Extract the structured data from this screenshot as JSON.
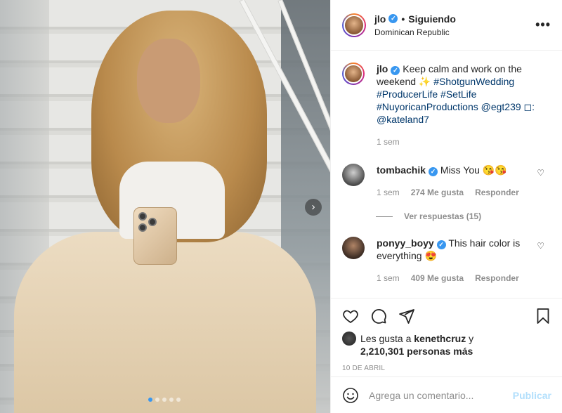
{
  "post": {
    "username": "jlo",
    "follow_label": "Siguiendo",
    "location": "Dominican Republic",
    "more_label": "•••",
    "carousel_next": "›",
    "carousel_dots": 5,
    "active_dot": 0
  },
  "caption": {
    "username": "jlo",
    "text": "Keep calm and work on the weekend ✨ ",
    "hashtags": "#ShotgunWedding #ProducerLife #SetLife #NuyoricanProductions @egt239 ◻: @kateland7",
    "time": "1 sem"
  },
  "comments": [
    {
      "username": "tombachik",
      "text": "Miss You 😘😘",
      "time": "1 sem",
      "likes": "274 Me gusta",
      "reply": "Responder",
      "view_replies": "Ver respuestas (15)"
    },
    {
      "username": "ponyy_boyy",
      "text": "This hair color is everything 😍",
      "time": "1 sem",
      "likes": "409 Me gusta",
      "reply": "Responder"
    }
  ],
  "likes_block": {
    "prefix": "Les gusta a ",
    "user": "kenethcruz",
    "suffix": " y",
    "count": "2,210,301 personas más"
  },
  "date": "10 DE ABRIL",
  "comment_box": {
    "placeholder": "Agrega un comentario...",
    "publish": "Publicar"
  },
  "colors": {
    "link": "#00376b",
    "verified": "#3897f0",
    "muted": "#8e8e8e",
    "publish_disabled": "#b2dffc"
  }
}
